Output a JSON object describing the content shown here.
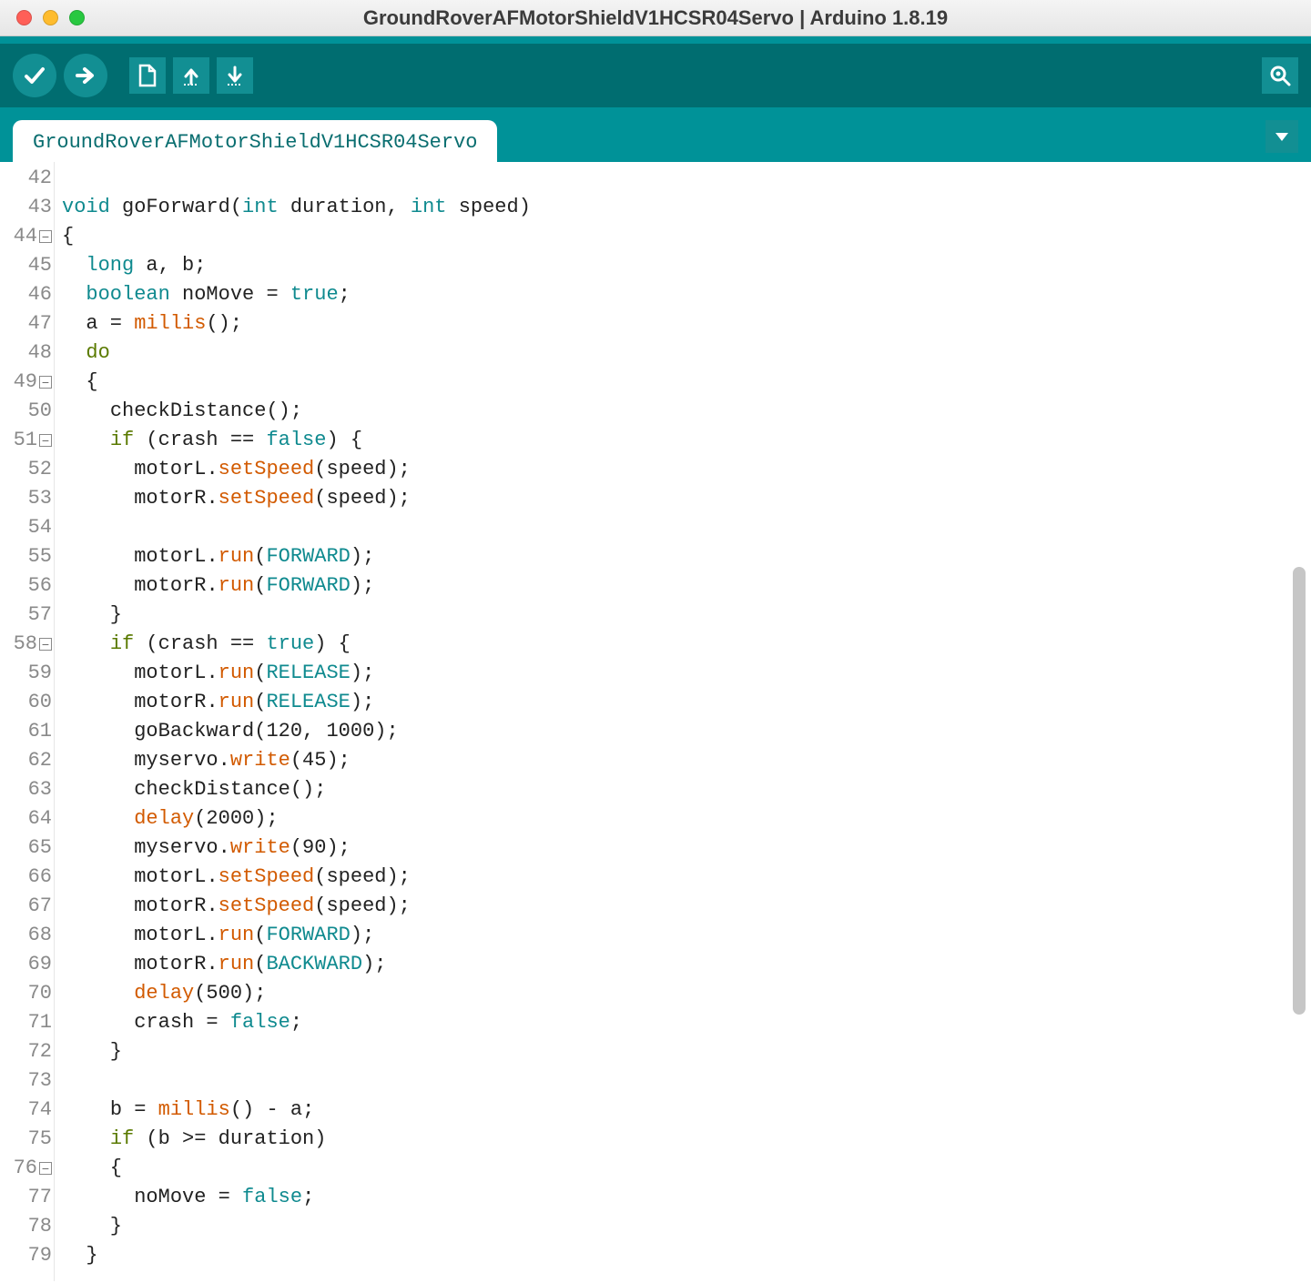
{
  "window": {
    "title": "GroundRoverAFMotorShieldV1HCSR04Servo | Arduino 1.8.19"
  },
  "toolbar": {
    "verify": "verify",
    "upload": "upload",
    "new": "new",
    "open": "open",
    "save": "save",
    "serial": "serial-monitor"
  },
  "tabs": {
    "active": "GroundRoverAFMotorShieldV1HCSR04Servo"
  },
  "editor": {
    "first_line_number": 42,
    "fold_lines": [
      44,
      49,
      51,
      58,
      76
    ],
    "lines": [
      {
        "raw": ""
      },
      {
        "raw": "void goForward(int duration, int speed)",
        "tokens": [
          [
            "ck",
            "void"
          ],
          [
            "cp",
            " "
          ],
          [
            "ci",
            "goForward"
          ],
          [
            "cp",
            "("
          ],
          [
            "ct",
            "int"
          ],
          [
            "cp",
            " "
          ],
          [
            "ci",
            "duration"
          ],
          [
            "cp",
            ", "
          ],
          [
            "ct",
            "int"
          ],
          [
            "cp",
            " "
          ],
          [
            "ci",
            "speed"
          ],
          [
            "cp",
            ")"
          ]
        ]
      },
      {
        "raw": "{",
        "tokens": [
          [
            "cp",
            "{"
          ]
        ]
      },
      {
        "raw": "  long a, b;",
        "tokens": [
          [
            "cp",
            "  "
          ],
          [
            "ct",
            "long"
          ],
          [
            "cp",
            " "
          ],
          [
            "ci",
            "a"
          ],
          [
            "cp",
            ", "
          ],
          [
            "ci",
            "b"
          ],
          [
            "cp",
            ";"
          ]
        ]
      },
      {
        "raw": "  boolean noMove = true;",
        "tokens": [
          [
            "cp",
            "  "
          ],
          [
            "ct",
            "boolean"
          ],
          [
            "cp",
            " "
          ],
          [
            "ci",
            "noMove"
          ],
          [
            "cp",
            " = "
          ],
          [
            "cb",
            "true"
          ],
          [
            "cp",
            ";"
          ]
        ]
      },
      {
        "raw": "  a = millis();",
        "tokens": [
          [
            "cp",
            "  "
          ],
          [
            "ci",
            "a"
          ],
          [
            "cp",
            " = "
          ],
          [
            "cm",
            "millis"
          ],
          [
            "cp",
            "();"
          ]
        ]
      },
      {
        "raw": "  do",
        "tokens": [
          [
            "cp",
            "  "
          ],
          [
            "cg",
            "do"
          ]
        ]
      },
      {
        "raw": "  {",
        "tokens": [
          [
            "cp",
            "  {"
          ]
        ]
      },
      {
        "raw": "    checkDistance();",
        "tokens": [
          [
            "cp",
            "    "
          ],
          [
            "ci",
            "checkDistance"
          ],
          [
            "cp",
            "();"
          ]
        ]
      },
      {
        "raw": "    if (crash == false) {",
        "tokens": [
          [
            "cp",
            "    "
          ],
          [
            "cg",
            "if"
          ],
          [
            "cp",
            " ("
          ],
          [
            "ci",
            "crash"
          ],
          [
            "cp",
            " == "
          ],
          [
            "cb",
            "false"
          ],
          [
            "cp",
            ") {"
          ]
        ]
      },
      {
        "raw": "      motorL.setSpeed(speed);",
        "tokens": [
          [
            "cp",
            "      "
          ],
          [
            "ci",
            "motorL"
          ],
          [
            "cp",
            "."
          ],
          [
            "cm",
            "setSpeed"
          ],
          [
            "cp",
            "("
          ],
          [
            "ci",
            "speed"
          ],
          [
            "cp",
            ");"
          ]
        ]
      },
      {
        "raw": "      motorR.setSpeed(speed);",
        "tokens": [
          [
            "cp",
            "      "
          ],
          [
            "ci",
            "motorR"
          ],
          [
            "cp",
            "."
          ],
          [
            "cm",
            "setSpeed"
          ],
          [
            "cp",
            "("
          ],
          [
            "ci",
            "speed"
          ],
          [
            "cp",
            ");"
          ]
        ]
      },
      {
        "raw": ""
      },
      {
        "raw": "      motorL.run(FORWARD);",
        "tokens": [
          [
            "cp",
            "      "
          ],
          [
            "ci",
            "motorL"
          ],
          [
            "cp",
            "."
          ],
          [
            "cm",
            "run"
          ],
          [
            "cp",
            "("
          ],
          [
            "cc",
            "FORWARD"
          ],
          [
            "cp",
            ");"
          ]
        ]
      },
      {
        "raw": "      motorR.run(FORWARD);",
        "tokens": [
          [
            "cp",
            "      "
          ],
          [
            "ci",
            "motorR"
          ],
          [
            "cp",
            "."
          ],
          [
            "cm",
            "run"
          ],
          [
            "cp",
            "("
          ],
          [
            "cc",
            "FORWARD"
          ],
          [
            "cp",
            ");"
          ]
        ]
      },
      {
        "raw": "    }",
        "tokens": [
          [
            "cp",
            "    }"
          ]
        ]
      },
      {
        "raw": "    if (crash == true) {",
        "tokens": [
          [
            "cp",
            "    "
          ],
          [
            "cg",
            "if"
          ],
          [
            "cp",
            " ("
          ],
          [
            "ci",
            "crash"
          ],
          [
            "cp",
            " == "
          ],
          [
            "cb",
            "true"
          ],
          [
            "cp",
            ") {"
          ]
        ]
      },
      {
        "raw": "      motorL.run(RELEASE);",
        "tokens": [
          [
            "cp",
            "      "
          ],
          [
            "ci",
            "motorL"
          ],
          [
            "cp",
            "."
          ],
          [
            "cm",
            "run"
          ],
          [
            "cp",
            "("
          ],
          [
            "cc",
            "RELEASE"
          ],
          [
            "cp",
            ");"
          ]
        ]
      },
      {
        "raw": "      motorR.run(RELEASE);",
        "tokens": [
          [
            "cp",
            "      "
          ],
          [
            "ci",
            "motorR"
          ],
          [
            "cp",
            "."
          ],
          [
            "cm",
            "run"
          ],
          [
            "cp",
            "("
          ],
          [
            "cc",
            "RELEASE"
          ],
          [
            "cp",
            ");"
          ]
        ]
      },
      {
        "raw": "      goBackward(120, 1000);",
        "tokens": [
          [
            "cp",
            "      "
          ],
          [
            "ci",
            "goBackward"
          ],
          [
            "cp",
            "(120, 1000);"
          ]
        ]
      },
      {
        "raw": "      myservo.write(45);",
        "tokens": [
          [
            "cp",
            "      "
          ],
          [
            "ci",
            "myservo"
          ],
          [
            "cp",
            "."
          ],
          [
            "cm",
            "write"
          ],
          [
            "cp",
            "(45);"
          ]
        ]
      },
      {
        "raw": "      checkDistance();",
        "tokens": [
          [
            "cp",
            "      "
          ],
          [
            "ci",
            "checkDistance"
          ],
          [
            "cp",
            "();"
          ]
        ]
      },
      {
        "raw": "      delay(2000);",
        "tokens": [
          [
            "cp",
            "      "
          ],
          [
            "cm",
            "delay"
          ],
          [
            "cp",
            "(2000);"
          ]
        ]
      },
      {
        "raw": "      myservo.write(90);",
        "tokens": [
          [
            "cp",
            "      "
          ],
          [
            "ci",
            "myservo"
          ],
          [
            "cp",
            "."
          ],
          [
            "cm",
            "write"
          ],
          [
            "cp",
            "(90);"
          ]
        ]
      },
      {
        "raw": "      motorL.setSpeed(speed);",
        "tokens": [
          [
            "cp",
            "      "
          ],
          [
            "ci",
            "motorL"
          ],
          [
            "cp",
            "."
          ],
          [
            "cm",
            "setSpeed"
          ],
          [
            "cp",
            "("
          ],
          [
            "ci",
            "speed"
          ],
          [
            "cp",
            ");"
          ]
        ]
      },
      {
        "raw": "      motorR.setSpeed(speed);",
        "tokens": [
          [
            "cp",
            "      "
          ],
          [
            "ci",
            "motorR"
          ],
          [
            "cp",
            "."
          ],
          [
            "cm",
            "setSpeed"
          ],
          [
            "cp",
            "("
          ],
          [
            "ci",
            "speed"
          ],
          [
            "cp",
            ");"
          ]
        ]
      },
      {
        "raw": "      motorL.run(FORWARD);",
        "tokens": [
          [
            "cp",
            "      "
          ],
          [
            "ci",
            "motorL"
          ],
          [
            "cp",
            "."
          ],
          [
            "cm",
            "run"
          ],
          [
            "cp",
            "("
          ],
          [
            "cc",
            "FORWARD"
          ],
          [
            "cp",
            ");"
          ]
        ]
      },
      {
        "raw": "      motorR.run(BACKWARD);",
        "tokens": [
          [
            "cp",
            "      "
          ],
          [
            "ci",
            "motorR"
          ],
          [
            "cp",
            "."
          ],
          [
            "cm",
            "run"
          ],
          [
            "cp",
            "("
          ],
          [
            "cc",
            "BACKWARD"
          ],
          [
            "cp",
            ");"
          ]
        ]
      },
      {
        "raw": "      delay(500);",
        "tokens": [
          [
            "cp",
            "      "
          ],
          [
            "cm",
            "delay"
          ],
          [
            "cp",
            "(500);"
          ]
        ]
      },
      {
        "raw": "      crash = false;",
        "tokens": [
          [
            "cp",
            "      "
          ],
          [
            "ci",
            "crash"
          ],
          [
            "cp",
            " = "
          ],
          [
            "cb",
            "false"
          ],
          [
            "cp",
            ";"
          ]
        ]
      },
      {
        "raw": "    }",
        "tokens": [
          [
            "cp",
            "    }"
          ]
        ]
      },
      {
        "raw": ""
      },
      {
        "raw": "    b = millis() - a;",
        "tokens": [
          [
            "cp",
            "    "
          ],
          [
            "ci",
            "b"
          ],
          [
            "cp",
            " = "
          ],
          [
            "cm",
            "millis"
          ],
          [
            "cp",
            "() - "
          ],
          [
            "ci",
            "a"
          ],
          [
            "cp",
            ";"
          ]
        ]
      },
      {
        "raw": "    if (b >= duration)",
        "tokens": [
          [
            "cp",
            "    "
          ],
          [
            "cg",
            "if"
          ],
          [
            "cp",
            " ("
          ],
          [
            "ci",
            "b"
          ],
          [
            "cp",
            " >= "
          ],
          [
            "ci",
            "duration"
          ],
          [
            "cp",
            ")"
          ]
        ]
      },
      {
        "raw": "    {",
        "tokens": [
          [
            "cp",
            "    {"
          ]
        ]
      },
      {
        "raw": "      noMove = false;",
        "tokens": [
          [
            "cp",
            "      "
          ],
          [
            "ci",
            "noMove"
          ],
          [
            "cp",
            " = "
          ],
          [
            "cb",
            "false"
          ],
          [
            "cp",
            ";"
          ]
        ]
      },
      {
        "raw": "    }",
        "tokens": [
          [
            "cp",
            "    }"
          ]
        ]
      },
      {
        "raw": "  }",
        "tokens": [
          [
            "cp",
            "  }"
          ]
        ]
      }
    ],
    "scrollbar": {
      "top_pct": 36,
      "height_pct": 40
    }
  }
}
